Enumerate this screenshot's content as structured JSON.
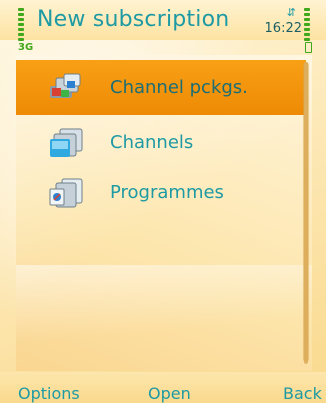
{
  "status_bar": {
    "title": "New subscription",
    "time": "16:22",
    "network_type": "3G",
    "net_icon": "packet-data-icon"
  },
  "menu": {
    "items": [
      {
        "label": "Channel pckgs.",
        "icon": "channel-packages-icon",
        "selected": true
      },
      {
        "label": "Channels",
        "icon": "channels-icon",
        "selected": false
      },
      {
        "label": "Programmes",
        "icon": "programmes-icon",
        "selected": false
      }
    ]
  },
  "softkeys": {
    "left": "Options",
    "center": "Open",
    "right": "Back"
  },
  "colors": {
    "accent_text": "#1d9aa3",
    "selection": "#f39512",
    "indicator": "#40a81a"
  }
}
